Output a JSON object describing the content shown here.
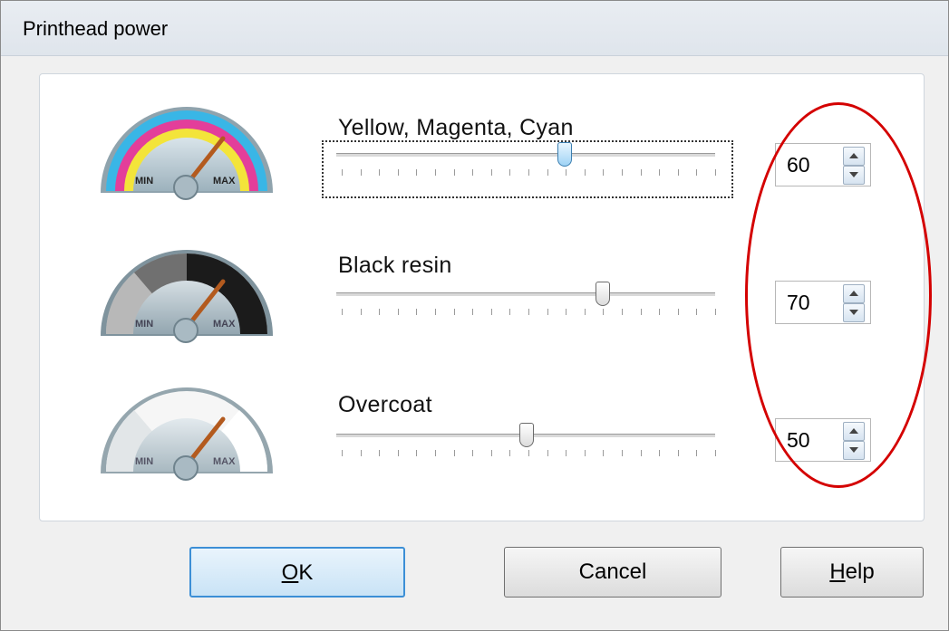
{
  "window": {
    "title": "Printhead power"
  },
  "rows": [
    {
      "label": "Yellow, Magenta, Cyan",
      "value": "60",
      "slider_level": 60,
      "gauge": {
        "min": "MIN",
        "max": "MAX",
        "style": "color"
      }
    },
    {
      "label": "Black resin",
      "value": "70",
      "slider_level": 70,
      "gauge": {
        "min": "MIN",
        "max": "MAX",
        "style": "black"
      }
    },
    {
      "label": "Overcoat",
      "value": "50",
      "slider_level": 50,
      "gauge": {
        "min": "MIN",
        "max": "MAX",
        "style": "overcoat"
      }
    }
  ],
  "buttons": {
    "ok": {
      "mnemonic": "O",
      "rest": "K"
    },
    "cancel": "Cancel",
    "help": {
      "mnemonic": "H",
      "rest": "elp"
    }
  },
  "colors": {
    "callout": "#d40000",
    "focus_thumb": "#9fd3f5",
    "cyan": "#39b6e6",
    "magenta": "#e33e9a",
    "yellow": "#f3e43a",
    "needle": "#b35a1e"
  }
}
